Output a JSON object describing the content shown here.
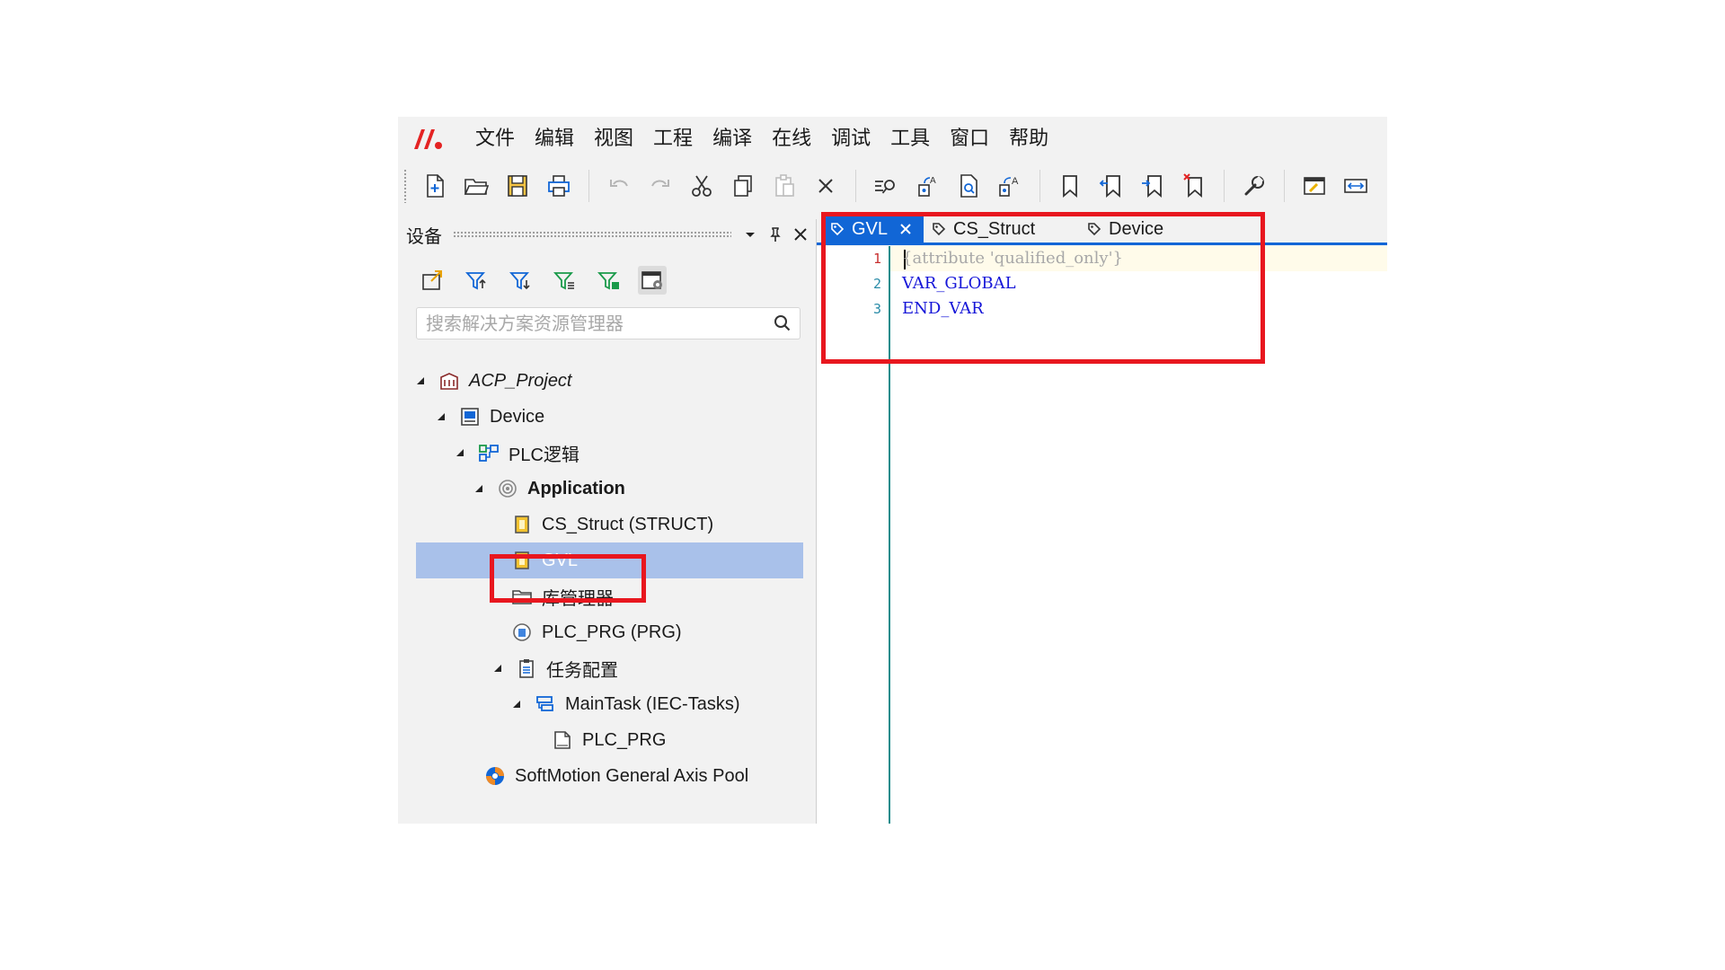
{
  "menu": {
    "items": [
      "文件",
      "编辑",
      "视图",
      "工程",
      "编译",
      "在线",
      "调试",
      "工具",
      "窗口",
      "帮助"
    ]
  },
  "toolbar": {
    "buttons": [
      "new-file-icon",
      "open-folder-icon",
      "save-icon",
      "print-icon",
      "undo-icon",
      "redo-icon",
      "cut-icon",
      "copy-icon",
      "paste-icon",
      "delete-icon",
      "find-icon",
      "replace-icon",
      "find-in-file-icon",
      "replace-in-file-icon",
      "bookmark-icon",
      "bookmark-prev-icon",
      "bookmark-next-icon",
      "bookmark-clear-icon",
      "settings-wrench-icon",
      "window-icon",
      "width-icon"
    ]
  },
  "devices_panel": {
    "title": "设备",
    "search": {
      "placeholder": "搜索解决方案资源管理器",
      "value": ""
    },
    "tree": [
      {
        "label": "ACP_Project",
        "icon": "project-icon",
        "expanded": true
      },
      {
        "label": "Device",
        "icon": "device-icon",
        "expanded": true
      },
      {
        "label": "PLC逻辑",
        "icon": "plc-logic-icon",
        "expanded": true
      },
      {
        "label": "Application",
        "icon": "application-icon",
        "expanded": true
      },
      {
        "label": "CS_Struct (STRUCT)",
        "icon": "struct-icon"
      },
      {
        "label": "GVL",
        "icon": "gvl-icon",
        "selected": true
      },
      {
        "label": "库管理器",
        "icon": "library-folder-icon"
      },
      {
        "label": "PLC_PRG (PRG)",
        "icon": "program-icon"
      },
      {
        "label": "任务配置",
        "icon": "task-config-icon",
        "expanded": true
      },
      {
        "label": "MainTask (IEC-Tasks)",
        "icon": "task-icon",
        "expanded": true
      },
      {
        "label": "PLC_PRG",
        "icon": "program-call-icon"
      },
      {
        "label": "SoftMotion General Axis Pool",
        "icon": "axis-pool-icon"
      }
    ]
  },
  "editor": {
    "tabs": [
      {
        "label": "GVL",
        "active": true
      },
      {
        "label": "CS_Struct",
        "active": false
      },
      {
        "label": "Device",
        "active": false
      }
    ],
    "lines": [
      {
        "no": "1",
        "text": "{attribute 'qualified_only'}"
      },
      {
        "no": "2",
        "text": "VAR_GLOBAL"
      },
      {
        "no": "3",
        "text": "END_VAR"
      }
    ]
  },
  "colors": {
    "accent": "#1166d6",
    "selection": "#a9c1ea",
    "highlight": "#e8171f",
    "keyword": "#1616d8",
    "gutter_line": "#1a8c8c",
    "logo": "#e42323"
  }
}
